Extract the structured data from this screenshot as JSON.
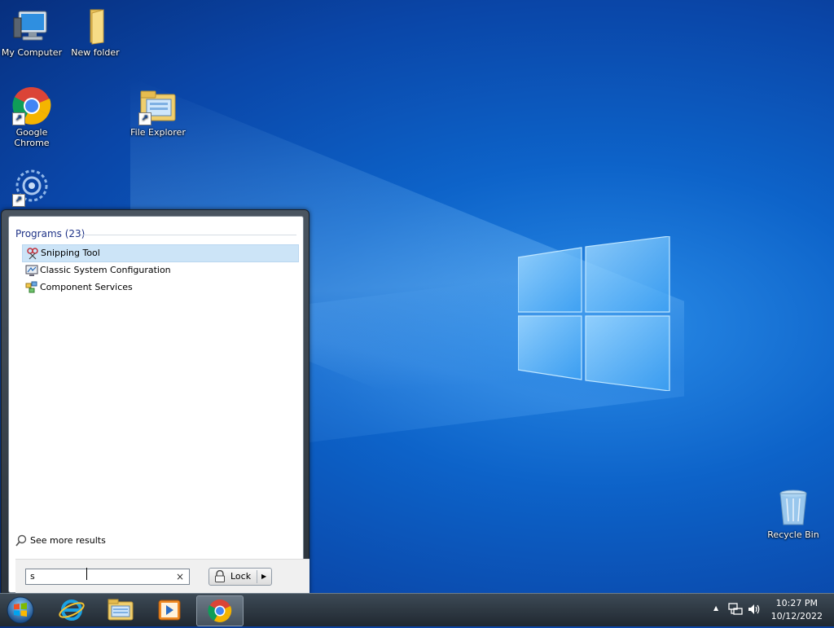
{
  "desktop": {
    "icons": [
      {
        "label": "My Computer"
      },
      {
        "label": "New folder"
      },
      {
        "label": "Google Chrome"
      },
      {
        "label": "File Explorer"
      },
      {
        "label": ""
      },
      {
        "label": "Recycle Bin"
      }
    ]
  },
  "start_menu": {
    "programs_header": "Programs (23)",
    "results": [
      {
        "label": "Snipping Tool",
        "icon": "snipping-tool-icon",
        "selected": true
      },
      {
        "label": "Classic System Configuration",
        "icon": "system-config-icon",
        "selected": false
      },
      {
        "label": "Component Services",
        "icon": "component-services-icon",
        "selected": false
      }
    ],
    "see_more": "See more results",
    "search": {
      "value": "s",
      "clear": "×"
    },
    "power_button": {
      "label": "Lock"
    }
  },
  "taskbar": {
    "pinned": [
      "start-orb",
      "internet-explorer-icon",
      "file-explorer-icon",
      "media-player-icon",
      "chrome-icon"
    ],
    "active": "chrome-icon",
    "tray": {
      "show_hidden": "▲"
    },
    "clock": {
      "time": "10:27 PM",
      "date": "10/12/2022"
    }
  }
}
